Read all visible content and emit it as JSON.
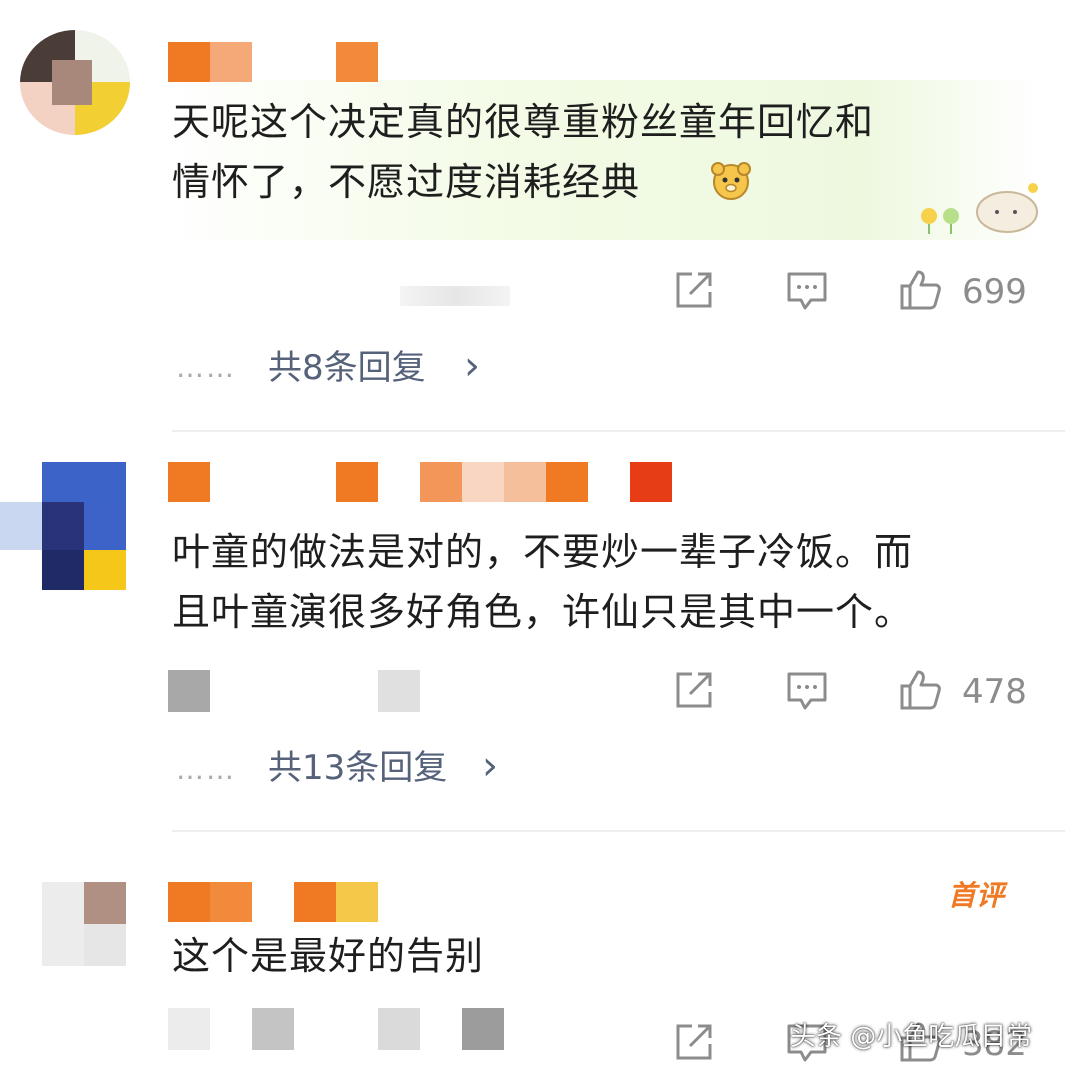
{
  "comments": [
    {
      "text_lines": [
        "天呢这个决定真的很尊重粉丝童年回忆和",
        "情怀了，不愿过度消耗经典"
      ],
      "likes": "699",
      "replies_label": "共8条回复",
      "replies_chevron": "›",
      "dots": "……",
      "emoji_icon": "dog-face-emoji-icon"
    },
    {
      "text_lines": [
        "叶童的做法是对的，不要炒一辈子冷饭。而",
        "且叶童演很多好角色，许仙只是其中一个。"
      ],
      "likes": "478",
      "replies_label": "共13条回复",
      "replies_chevron": "›",
      "dots": "……"
    },
    {
      "text_lines": [
        "这个是最好的告别"
      ],
      "badge": "首评",
      "likes": "382"
    }
  ],
  "watermark": "头条 @小鱼吃瓜日常",
  "colors": {
    "reply_link": "#55627a",
    "count_gray": "#8c8c8c",
    "badge_orange": "#f07a24",
    "name_mosaic_orange": "#f07a24"
  },
  "icons": [
    "share-icon",
    "comment-icon",
    "thumbs-up-icon",
    "chevron-right-icon"
  ]
}
